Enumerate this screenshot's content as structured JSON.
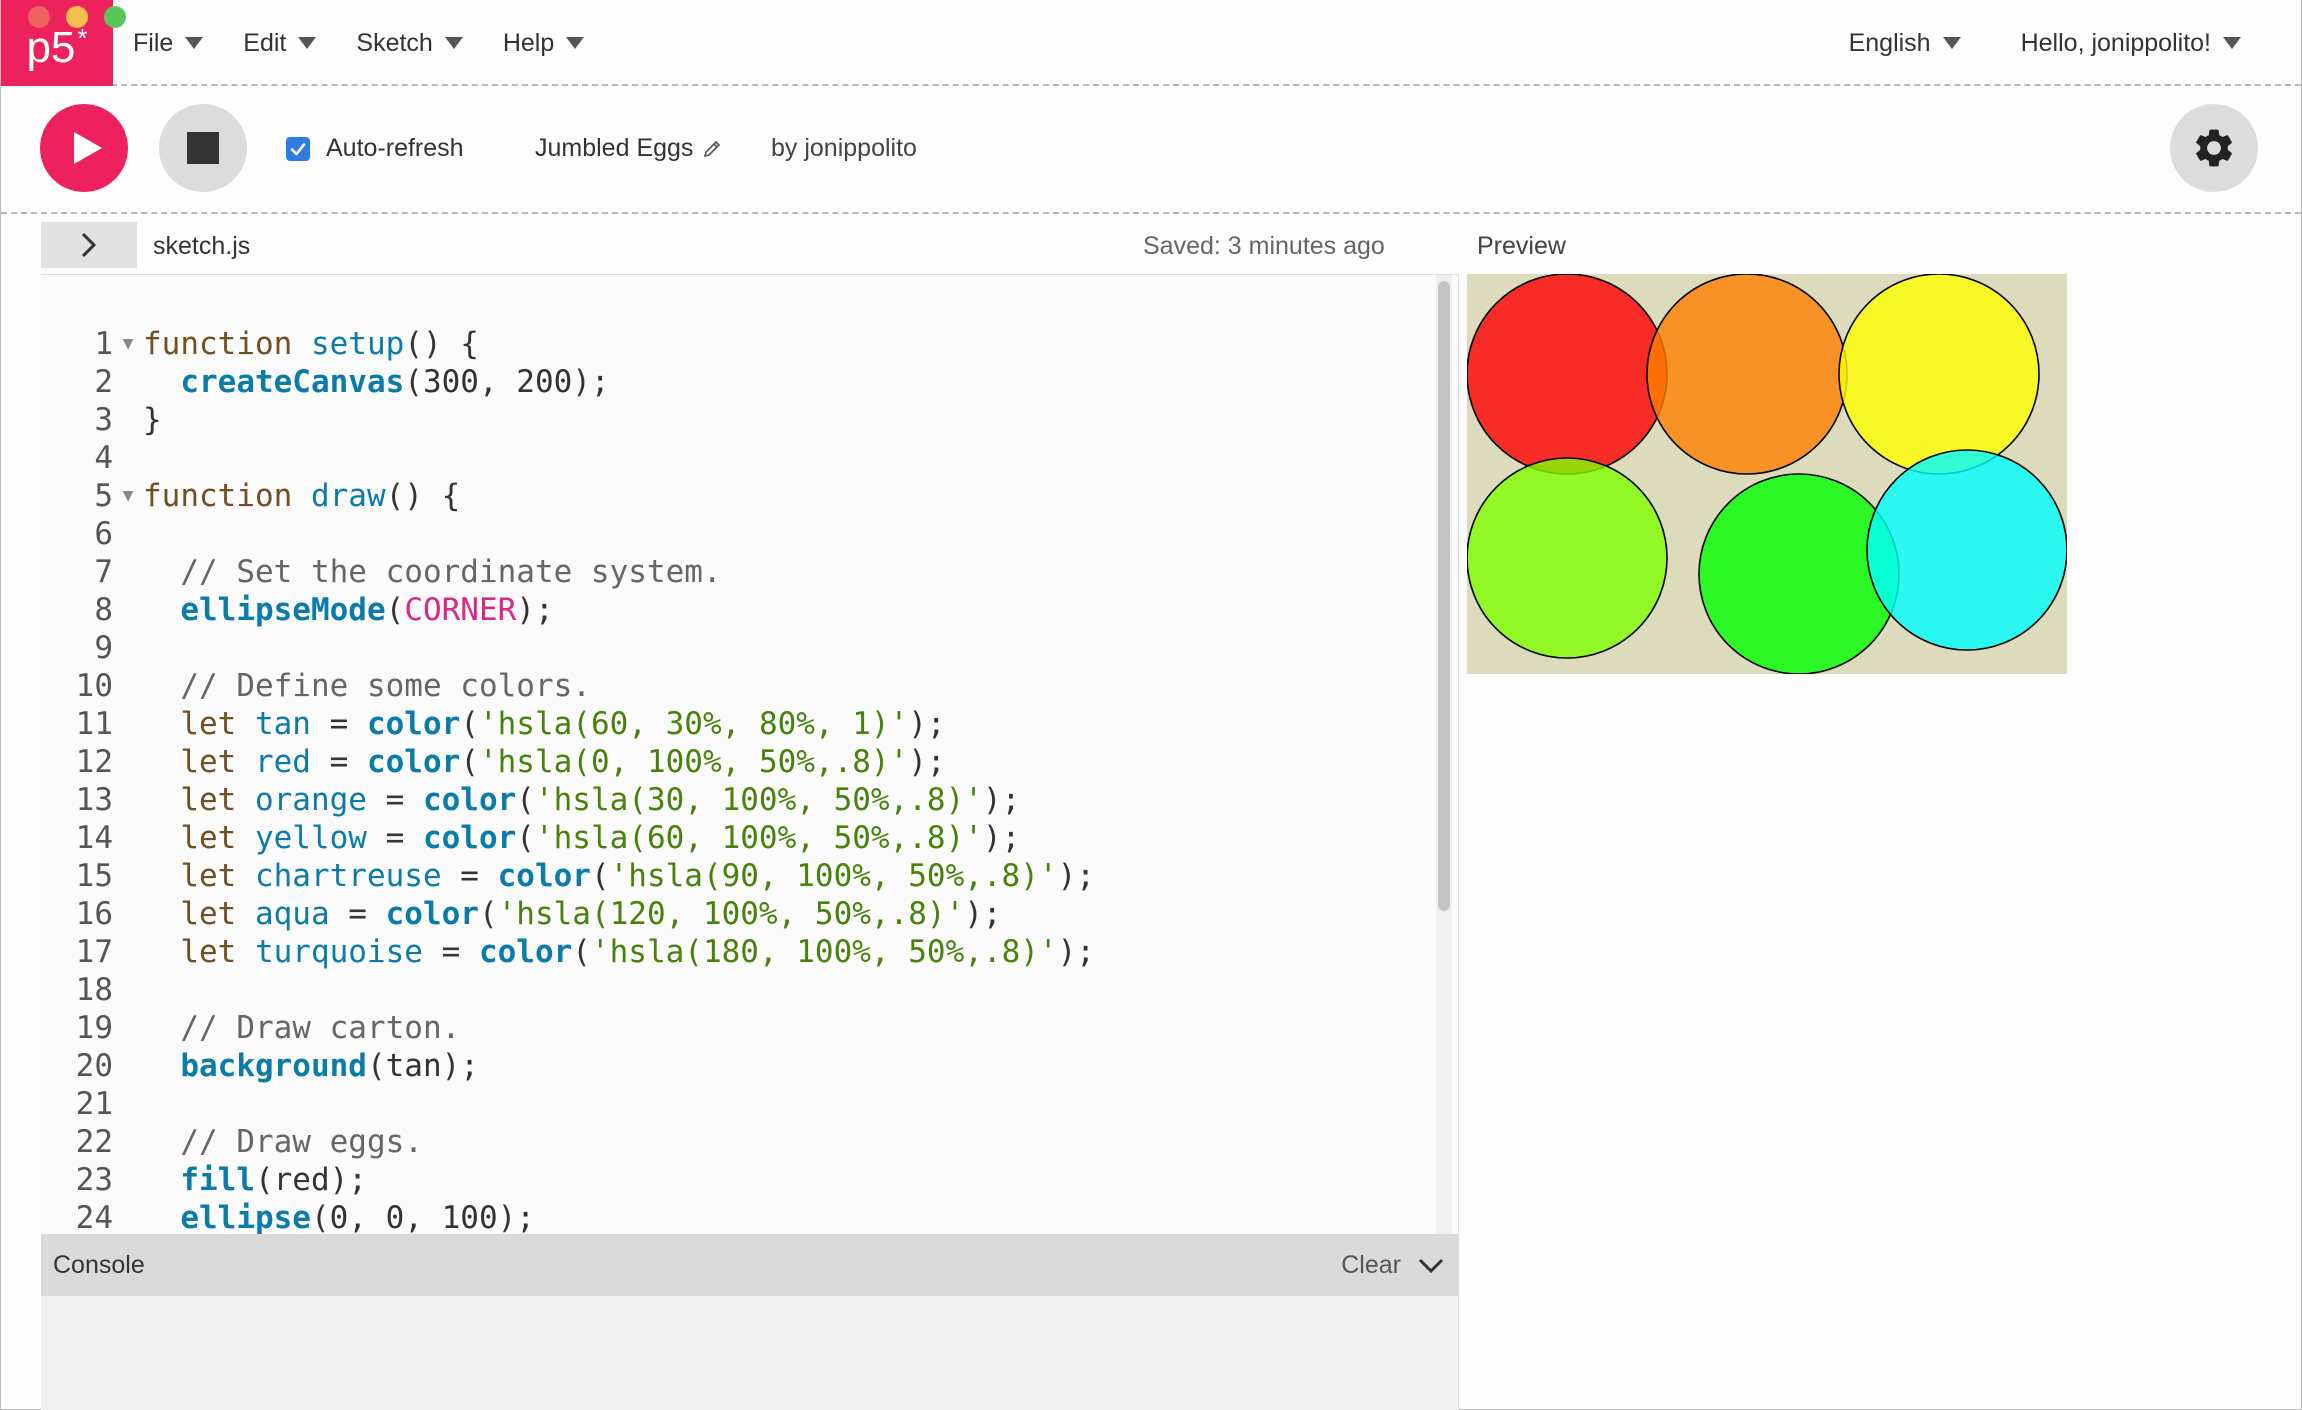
{
  "logo": {
    "text": "p5",
    "star": "*"
  },
  "nav": {
    "menus": [
      {
        "label": "File"
      },
      {
        "label": "Edit"
      },
      {
        "label": "Sketch"
      },
      {
        "label": "Help"
      }
    ],
    "language": "English",
    "user_greeting": "Hello, jonippolito!"
  },
  "toolbar": {
    "auto_refresh_label": "Auto-refresh",
    "auto_refresh_checked": true,
    "sketch_name": "Jumbled Eggs",
    "by_user": "by jonippolito"
  },
  "editor": {
    "file_name": "sketch.js",
    "saved_status": "Saved: 3 minutes ago",
    "lines": [
      {
        "n": "1",
        "fold": true,
        "code": [
          [
            "kw",
            "function "
          ],
          [
            "fdef",
            "setup"
          ],
          [
            "src",
            "() {"
          ]
        ]
      },
      {
        "n": "2",
        "code": [
          [
            "src",
            "  "
          ],
          [
            "fn",
            "createCanvas"
          ],
          [
            "src",
            "(300, 200);"
          ]
        ]
      },
      {
        "n": "3",
        "code": [
          [
            "src",
            "}"
          ]
        ]
      },
      {
        "n": "4",
        "code": []
      },
      {
        "n": "5",
        "fold": true,
        "code": [
          [
            "kw",
            "function "
          ],
          [
            "fdef",
            "draw"
          ],
          [
            "src",
            "() {"
          ]
        ]
      },
      {
        "n": "6",
        "code": []
      },
      {
        "n": "7",
        "code": [
          [
            "cmt",
            "  // Set the coordinate system."
          ]
        ]
      },
      {
        "n": "8",
        "code": [
          [
            "src",
            "  "
          ],
          [
            "fn",
            "ellipseMode"
          ],
          [
            "src",
            "("
          ],
          [
            "const",
            "CORNER"
          ],
          [
            "src",
            ");"
          ]
        ]
      },
      {
        "n": "9",
        "code": []
      },
      {
        "n": "10",
        "code": [
          [
            "cmt",
            "  // Define some colors."
          ]
        ]
      },
      {
        "n": "11",
        "code": [
          [
            "kw",
            "  let "
          ],
          [
            "fdef",
            "tan"
          ],
          [
            "src",
            " = "
          ],
          [
            "fn",
            "color"
          ],
          [
            "src",
            "("
          ],
          [
            "str",
            "'hsla(60, 30%, 80%, 1)'"
          ],
          [
            "src",
            ");"
          ]
        ]
      },
      {
        "n": "12",
        "code": [
          [
            "kw",
            "  let "
          ],
          [
            "fdef",
            "red"
          ],
          [
            "src",
            " = "
          ],
          [
            "fn",
            "color"
          ],
          [
            "src",
            "("
          ],
          [
            "str",
            "'hsla(0, 100%, 50%,.8)'"
          ],
          [
            "src",
            ");"
          ]
        ]
      },
      {
        "n": "13",
        "code": [
          [
            "kw",
            "  let "
          ],
          [
            "fdef",
            "orange"
          ],
          [
            "src",
            " = "
          ],
          [
            "fn",
            "color"
          ],
          [
            "src",
            "("
          ],
          [
            "str",
            "'hsla(30, 100%, 50%,.8)'"
          ],
          [
            "src",
            ");"
          ]
        ]
      },
      {
        "n": "14",
        "code": [
          [
            "kw",
            "  let "
          ],
          [
            "fdef",
            "yellow"
          ],
          [
            "src",
            " = "
          ],
          [
            "fn",
            "color"
          ],
          [
            "src",
            "("
          ],
          [
            "str",
            "'hsla(60, 100%, 50%,.8)'"
          ],
          [
            "src",
            ");"
          ]
        ]
      },
      {
        "n": "15",
        "code": [
          [
            "kw",
            "  let "
          ],
          [
            "fdef",
            "chartreuse"
          ],
          [
            "src",
            " = "
          ],
          [
            "fn",
            "color"
          ],
          [
            "src",
            "("
          ],
          [
            "str",
            "'hsla(90, 100%, 50%,.8)'"
          ],
          [
            "src",
            ");"
          ]
        ]
      },
      {
        "n": "16",
        "code": [
          [
            "kw",
            "  let "
          ],
          [
            "fdef",
            "aqua"
          ],
          [
            "src",
            " = "
          ],
          [
            "fn",
            "color"
          ],
          [
            "src",
            "("
          ],
          [
            "str",
            "'hsla(120, 100%, 50%,.8)'"
          ],
          [
            "src",
            ");"
          ]
        ]
      },
      {
        "n": "17",
        "code": [
          [
            "kw",
            "  let "
          ],
          [
            "fdef",
            "turquoise"
          ],
          [
            "src",
            " = "
          ],
          [
            "fn",
            "color"
          ],
          [
            "src",
            "("
          ],
          [
            "str",
            "'hsla(180, 100%, 50%,.8)'"
          ],
          [
            "src",
            ");"
          ]
        ]
      },
      {
        "n": "18",
        "code": []
      },
      {
        "n": "19",
        "code": [
          [
            "cmt",
            "  // Draw carton."
          ]
        ]
      },
      {
        "n": "20",
        "code": [
          [
            "src",
            "  "
          ],
          [
            "fn",
            "background"
          ],
          [
            "src",
            "(tan);"
          ]
        ]
      },
      {
        "n": "21",
        "code": []
      },
      {
        "n": "22",
        "code": [
          [
            "cmt",
            "  // Draw eggs."
          ]
        ]
      },
      {
        "n": "23",
        "code": [
          [
            "src",
            "  "
          ],
          [
            "fn",
            "fill"
          ],
          [
            "src",
            "(red);"
          ]
        ]
      },
      {
        "n": "24",
        "code": [
          [
            "src",
            "  "
          ],
          [
            "fn",
            "ellipse"
          ],
          [
            "src",
            "(0, 0, 100);"
          ]
        ]
      }
    ]
  },
  "console": {
    "title": "Console",
    "clear_label": "Clear"
  },
  "preview": {
    "label": "Preview",
    "background": "#dcdcbc",
    "eggs": [
      {
        "name": "red",
        "color": "hsla(0, 100%, 50%, .8)"
      },
      {
        "name": "orange",
        "color": "hsla(30, 100%, 50%, .8)"
      },
      {
        "name": "yellow",
        "color": "hsla(60, 100%, 50%, .8)"
      },
      {
        "name": "chartreuse",
        "color": "hsla(90, 100%, 50%, .8)"
      },
      {
        "name": "aqua",
        "color": "hsla(120, 100%, 50%, .8)"
      },
      {
        "name": "turquoise",
        "color": "hsla(180, 100%, 50%, .8)"
      }
    ]
  },
  "colors": {
    "brand": "#ed225d",
    "checkbox": "#2f7de1"
  }
}
